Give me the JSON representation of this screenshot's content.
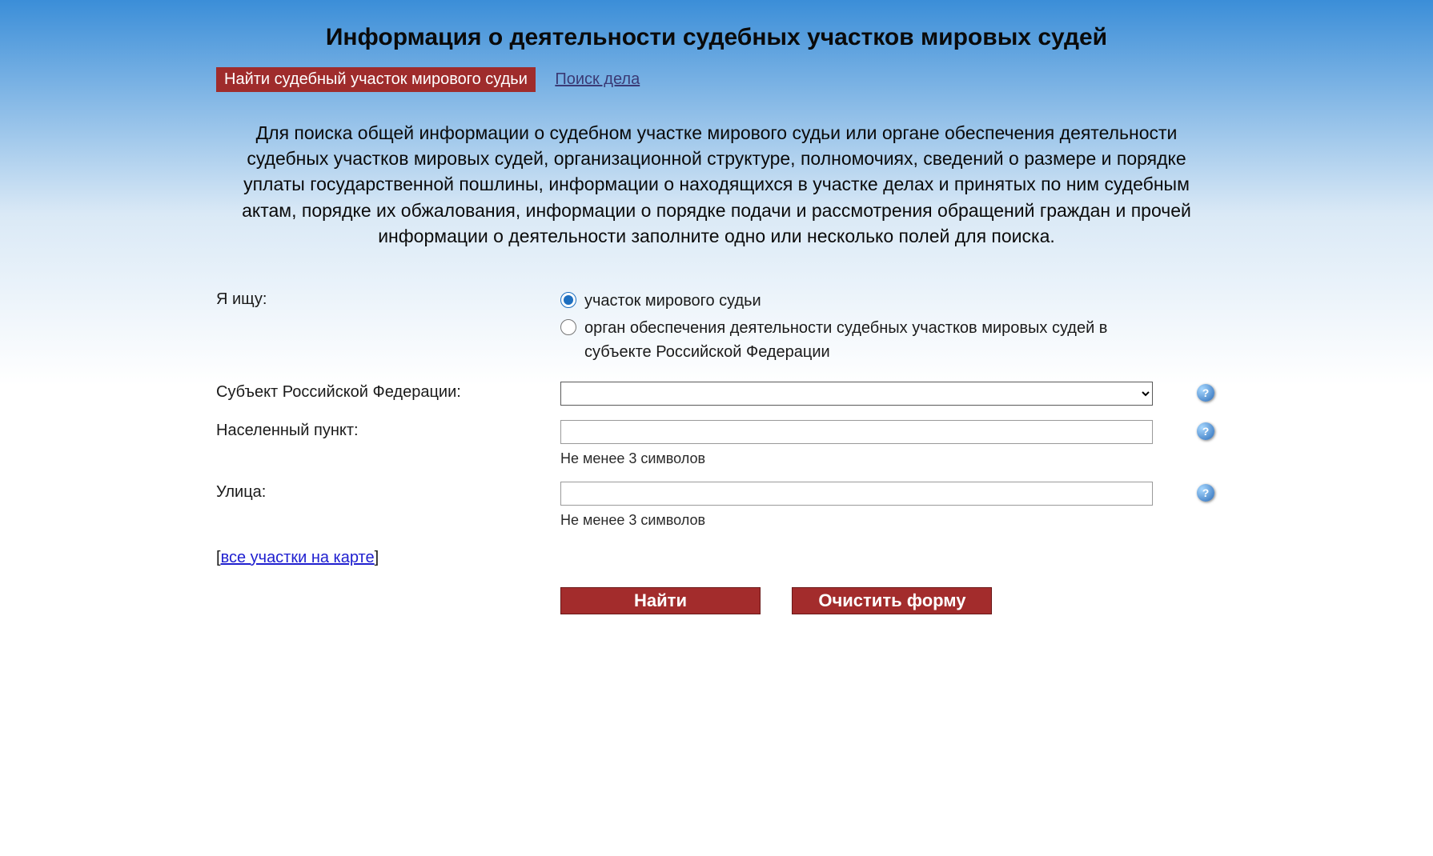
{
  "page": {
    "title": "Информация о деятельности судебных участков мировых судей"
  },
  "tabs": {
    "active": "Найти судебный участок мирового судьи",
    "secondary": "Поиск дела"
  },
  "description": "Для поиска общей информации о судебном участке мирового судьи или органе обеспечения деятельности судебных участков мировых судей, организационной структуре, полномочиях, сведений о размере и порядке уплаты государственной пошлины, информации о находящихся в участке делах и принятых по ним судебным актам, порядке их обжалования, информации о порядке подачи и рассмотрения обращений граждан и прочей информации о деятельности заполните одно или несколько полей для поиска.",
  "form": {
    "searchingFor": {
      "label": "Я ищу:",
      "option1": "участок мирового судьи",
      "option2": "орган обеспечения деятельности судебных участков мировых судей в субъекте Российской Федерации"
    },
    "subject": {
      "label": "Субъект Российской Федерации:",
      "value": ""
    },
    "locality": {
      "label": "Населенный пункт:",
      "value": "",
      "hint": "Не менее 3 символов"
    },
    "street": {
      "label": "Улица:",
      "value": "",
      "hint": "Не менее 3 символов"
    }
  },
  "mapLink": "все участки на карте",
  "buttons": {
    "search": "Найти",
    "clear": "Очистить форму"
  },
  "helpIcon": "?"
}
